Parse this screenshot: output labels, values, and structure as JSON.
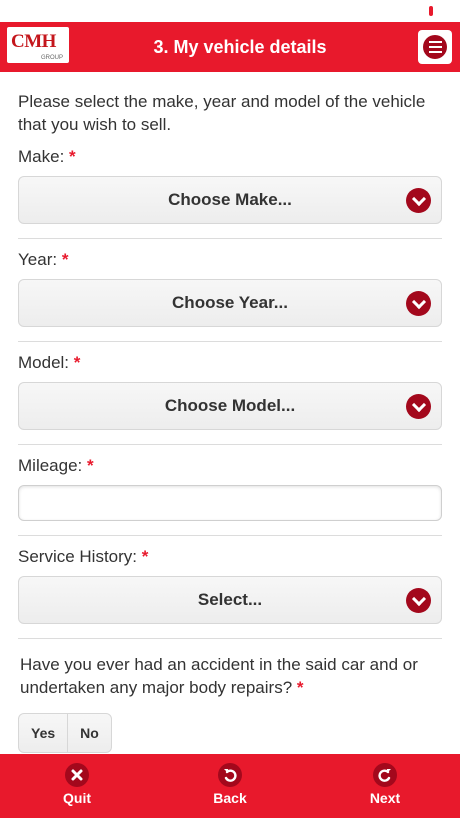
{
  "header": {
    "logo_text": "CMH",
    "logo_sub": "GROUP",
    "title": "3. My vehicle details",
    "menu_icon": "menu-icon"
  },
  "form": {
    "intro": "Please select the make, year and model of the vehicle that you wish to sell.",
    "make": {
      "label": "Make:",
      "required": "*",
      "value": "Choose Make..."
    },
    "year": {
      "label": "Year:",
      "required": "*",
      "value": "Choose Year..."
    },
    "model": {
      "label": "Model:",
      "required": "*",
      "value": "Choose Model..."
    },
    "mileage": {
      "label": "Mileage:",
      "required": "*",
      "value": ""
    },
    "service_history": {
      "label": "Service History:",
      "required": "*",
      "value": "Select..."
    },
    "accident": {
      "question": "Have you ever had an accident in the said car and or undertaken any major body repairs?",
      "required": "*",
      "options": [
        "Yes",
        "No"
      ]
    }
  },
  "footer": {
    "quit": {
      "label": "Quit",
      "icon": "close-icon"
    },
    "back": {
      "label": "Back",
      "icon": "undo-icon"
    },
    "next": {
      "label": "Next",
      "icon": "redo-icon"
    }
  },
  "colors": {
    "brand_red": "#e8192c",
    "dark_red": "#a3081c"
  }
}
